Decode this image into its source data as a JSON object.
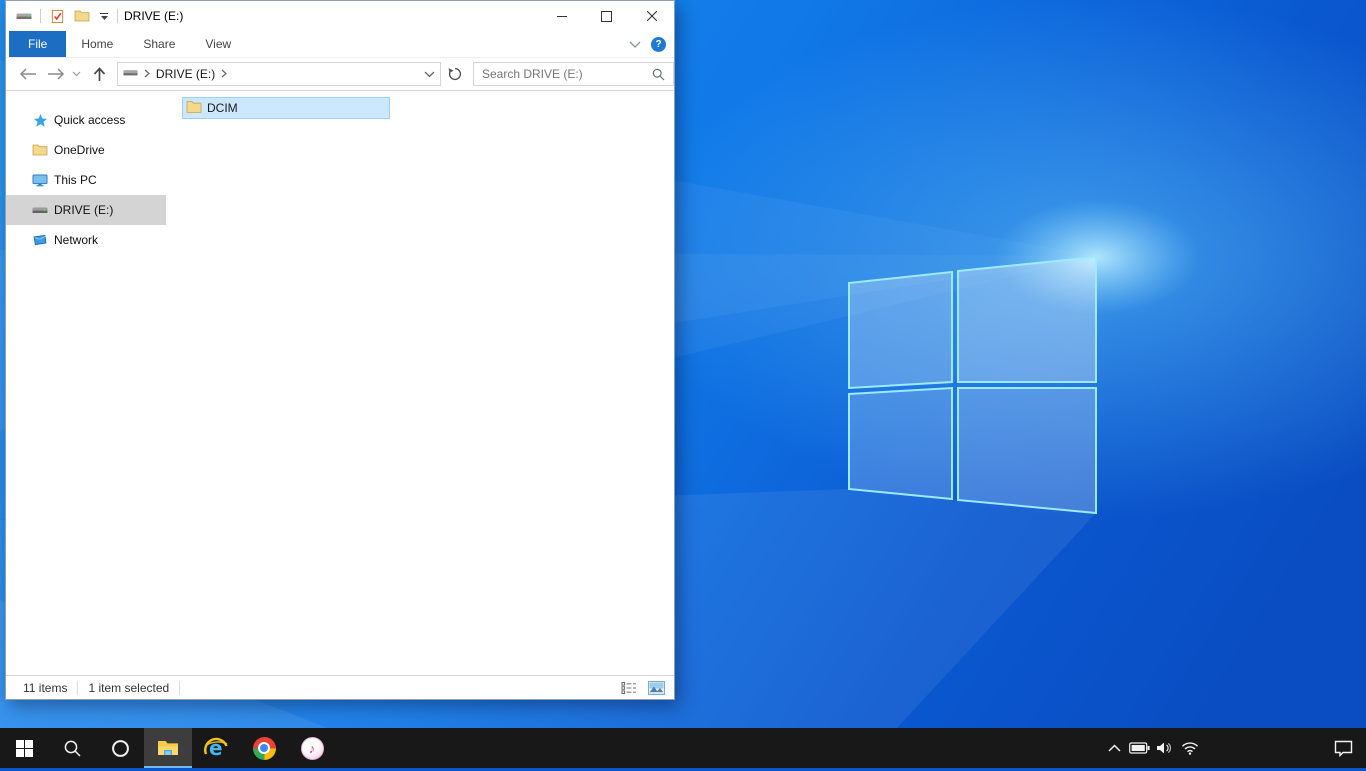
{
  "explorer": {
    "title": "DRIVE (E:)",
    "ribbon_tabs": [
      {
        "label": "File"
      },
      {
        "label": "Home"
      },
      {
        "label": "Share"
      },
      {
        "label": "View"
      }
    ],
    "help_glyph": "?",
    "breadcrumb": {
      "location": "DRIVE (E:)"
    },
    "search": {
      "placeholder": "Search DRIVE (E:)"
    },
    "sidebar": [
      {
        "label": "Quick access",
        "icon": "quick-access-star",
        "selected": false
      },
      {
        "label": "OneDrive",
        "icon": "folder",
        "selected": false
      },
      {
        "label": "This PC",
        "icon": "monitor",
        "selected": false
      },
      {
        "label": "DRIVE (E:)",
        "icon": "drive",
        "selected": true
      },
      {
        "label": "Network",
        "icon": "network",
        "selected": false
      }
    ],
    "files": [
      {
        "name": "DCIM",
        "icon": "folder",
        "selected": true
      }
    ],
    "status": {
      "count": "11 items",
      "selected": "1 item selected"
    }
  },
  "taskbar": {
    "buttons": [
      "start",
      "search",
      "cortana",
      "file-explorer",
      "internet-explorer",
      "chrome",
      "itunes"
    ],
    "active_button": "file-explorer",
    "tray_icons": [
      "hidden-icons-chevron",
      "battery",
      "volume",
      "wifi",
      "action-center"
    ]
  },
  "colors": {
    "file_tab_blue": "#1b6ec2",
    "selection_fill": "#cce8ff",
    "selection_border": "#99d1ff",
    "sidebar_selected": "#d4d4d4",
    "taskbar_bg": "#181818",
    "taskbar_active_underline": "#76b9ed",
    "wallpaper_deep_blue": "#0a4dc2",
    "wallpaper_azure": "#1e8ff0",
    "logo_stroke": "#9deaff"
  }
}
